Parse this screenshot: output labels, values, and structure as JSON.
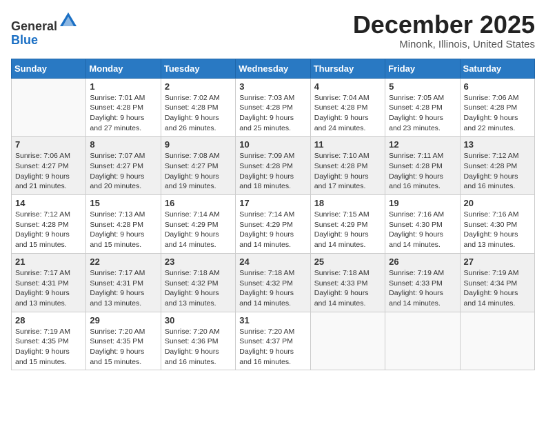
{
  "logo": {
    "general": "General",
    "blue": "Blue"
  },
  "title": "December 2025",
  "location": "Minonk, Illinois, United States",
  "days_of_week": [
    "Sunday",
    "Monday",
    "Tuesday",
    "Wednesday",
    "Thursday",
    "Friday",
    "Saturday"
  ],
  "weeks": [
    [
      {
        "day": "",
        "info": ""
      },
      {
        "day": "1",
        "info": "Sunrise: 7:01 AM\nSunset: 4:28 PM\nDaylight: 9 hours\nand 27 minutes."
      },
      {
        "day": "2",
        "info": "Sunrise: 7:02 AM\nSunset: 4:28 PM\nDaylight: 9 hours\nand 26 minutes."
      },
      {
        "day": "3",
        "info": "Sunrise: 7:03 AM\nSunset: 4:28 PM\nDaylight: 9 hours\nand 25 minutes."
      },
      {
        "day": "4",
        "info": "Sunrise: 7:04 AM\nSunset: 4:28 PM\nDaylight: 9 hours\nand 24 minutes."
      },
      {
        "day": "5",
        "info": "Sunrise: 7:05 AM\nSunset: 4:28 PM\nDaylight: 9 hours\nand 23 minutes."
      },
      {
        "day": "6",
        "info": "Sunrise: 7:06 AM\nSunset: 4:28 PM\nDaylight: 9 hours\nand 22 minutes."
      }
    ],
    [
      {
        "day": "7",
        "info": "Sunrise: 7:06 AM\nSunset: 4:27 PM\nDaylight: 9 hours\nand 21 minutes."
      },
      {
        "day": "8",
        "info": "Sunrise: 7:07 AM\nSunset: 4:27 PM\nDaylight: 9 hours\nand 20 minutes."
      },
      {
        "day": "9",
        "info": "Sunrise: 7:08 AM\nSunset: 4:27 PM\nDaylight: 9 hours\nand 19 minutes."
      },
      {
        "day": "10",
        "info": "Sunrise: 7:09 AM\nSunset: 4:28 PM\nDaylight: 9 hours\nand 18 minutes."
      },
      {
        "day": "11",
        "info": "Sunrise: 7:10 AM\nSunset: 4:28 PM\nDaylight: 9 hours\nand 17 minutes."
      },
      {
        "day": "12",
        "info": "Sunrise: 7:11 AM\nSunset: 4:28 PM\nDaylight: 9 hours\nand 16 minutes."
      },
      {
        "day": "13",
        "info": "Sunrise: 7:12 AM\nSunset: 4:28 PM\nDaylight: 9 hours\nand 16 minutes."
      }
    ],
    [
      {
        "day": "14",
        "info": "Sunrise: 7:12 AM\nSunset: 4:28 PM\nDaylight: 9 hours\nand 15 minutes."
      },
      {
        "day": "15",
        "info": "Sunrise: 7:13 AM\nSunset: 4:28 PM\nDaylight: 9 hours\nand 15 minutes."
      },
      {
        "day": "16",
        "info": "Sunrise: 7:14 AM\nSunset: 4:29 PM\nDaylight: 9 hours\nand 14 minutes."
      },
      {
        "day": "17",
        "info": "Sunrise: 7:14 AM\nSunset: 4:29 PM\nDaylight: 9 hours\nand 14 minutes."
      },
      {
        "day": "18",
        "info": "Sunrise: 7:15 AM\nSunset: 4:29 PM\nDaylight: 9 hours\nand 14 minutes."
      },
      {
        "day": "19",
        "info": "Sunrise: 7:16 AM\nSunset: 4:30 PM\nDaylight: 9 hours\nand 14 minutes."
      },
      {
        "day": "20",
        "info": "Sunrise: 7:16 AM\nSunset: 4:30 PM\nDaylight: 9 hours\nand 13 minutes."
      }
    ],
    [
      {
        "day": "21",
        "info": "Sunrise: 7:17 AM\nSunset: 4:31 PM\nDaylight: 9 hours\nand 13 minutes."
      },
      {
        "day": "22",
        "info": "Sunrise: 7:17 AM\nSunset: 4:31 PM\nDaylight: 9 hours\nand 13 minutes."
      },
      {
        "day": "23",
        "info": "Sunrise: 7:18 AM\nSunset: 4:32 PM\nDaylight: 9 hours\nand 13 minutes."
      },
      {
        "day": "24",
        "info": "Sunrise: 7:18 AM\nSunset: 4:32 PM\nDaylight: 9 hours\nand 14 minutes."
      },
      {
        "day": "25",
        "info": "Sunrise: 7:18 AM\nSunset: 4:33 PM\nDaylight: 9 hours\nand 14 minutes."
      },
      {
        "day": "26",
        "info": "Sunrise: 7:19 AM\nSunset: 4:33 PM\nDaylight: 9 hours\nand 14 minutes."
      },
      {
        "day": "27",
        "info": "Sunrise: 7:19 AM\nSunset: 4:34 PM\nDaylight: 9 hours\nand 14 minutes."
      }
    ],
    [
      {
        "day": "28",
        "info": "Sunrise: 7:19 AM\nSunset: 4:35 PM\nDaylight: 9 hours\nand 15 minutes."
      },
      {
        "day": "29",
        "info": "Sunrise: 7:20 AM\nSunset: 4:35 PM\nDaylight: 9 hours\nand 15 minutes."
      },
      {
        "day": "30",
        "info": "Sunrise: 7:20 AM\nSunset: 4:36 PM\nDaylight: 9 hours\nand 16 minutes."
      },
      {
        "day": "31",
        "info": "Sunrise: 7:20 AM\nSunset: 4:37 PM\nDaylight: 9 hours\nand 16 minutes."
      },
      {
        "day": "",
        "info": ""
      },
      {
        "day": "",
        "info": ""
      },
      {
        "day": "",
        "info": ""
      }
    ]
  ]
}
